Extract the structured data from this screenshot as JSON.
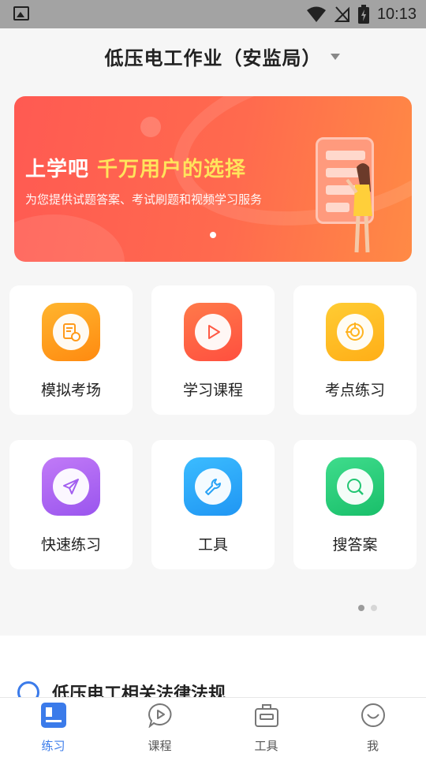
{
  "status_bar": {
    "time": "10:13",
    "icons": [
      "image-icon",
      "wifi-icon",
      "signal-off-icon",
      "battery-charging-icon"
    ]
  },
  "header": {
    "title": "低压电工作业（安监局）",
    "dropdown_icon": "caret-down-icon"
  },
  "banner": {
    "headline_part1": "上学吧",
    "headline_part2": "千万用户的选择",
    "subtitle": "为您提供试题答案、考试刷题和视频学习服务",
    "accent_color": "#ff5a52",
    "highlight_color": "#ffe45c",
    "carousel_pages": 1,
    "carousel_active": 1
  },
  "features": [
    {
      "label": "模拟考场",
      "icon": "exam-paper-icon",
      "color_from": "#ffb52e",
      "color_to": "#ff8a10"
    },
    {
      "label": "学习课程",
      "icon": "play-icon",
      "color_from": "#ff7a4a",
      "color_to": "#ff4f3f"
    },
    {
      "label": "考点练习",
      "icon": "target-icon",
      "color_from": "#ffcc33",
      "color_to": "#ffae17"
    },
    {
      "label": "快速练习",
      "icon": "paper-plane-icon",
      "color_from": "#c17af7",
      "color_to": "#9a55ee"
    },
    {
      "label": "工具",
      "icon": "wrench-icon",
      "color_from": "#3bbcff",
      "color_to": "#2096f3"
    },
    {
      "label": "搜答案",
      "icon": "search-icon",
      "color_from": "#3fdc8c",
      "color_to": "#19bf6a"
    }
  ],
  "feature_pager": {
    "pages": 2,
    "active": 1
  },
  "section": {
    "title": "低压电工相关法律法规",
    "icon": "chevron-circle-icon"
  },
  "tabbar": {
    "items": [
      {
        "label": "练习",
        "icon": "book-icon",
        "active": true
      },
      {
        "label": "课程",
        "icon": "chat-play-icon",
        "active": false
      },
      {
        "label": "工具",
        "icon": "toolbox-icon",
        "active": false
      },
      {
        "label": "我",
        "icon": "smile-icon",
        "active": false
      }
    ],
    "active_color": "#3b7bea"
  }
}
